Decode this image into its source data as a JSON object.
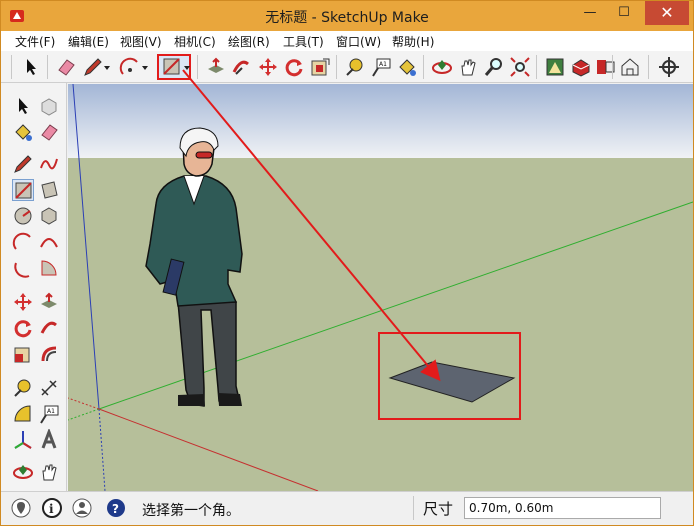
{
  "window": {
    "title": "无标题 - SketchUp Make",
    "minimize_glyph": "—",
    "maximize_glyph": "☐",
    "close_glyph": "✕"
  },
  "menu": {
    "items": [
      "文件(F)",
      "编辑(E)",
      "视图(V)",
      "相机(C)",
      "绘图(R)",
      "工具(T)",
      "窗口(W)",
      "帮助(H)"
    ]
  },
  "toolbar": {
    "icons": [
      "select-icon",
      "eraser-icon",
      "pencil-icon",
      "arc-icon",
      "rectangle-icon",
      "push-pull-icon",
      "follow-me-icon",
      "move-icon",
      "rotate-icon",
      "offset-icon",
      "tape-measure-icon",
      "text-icon",
      "paint-bucket-icon",
      "orbit-icon",
      "pan-icon",
      "zoom-icon",
      "zoom-extents-icon",
      "3d-warehouse-icon",
      "extension-icon",
      "components-icon",
      "house-icon",
      "position-camera-icon"
    ],
    "active": "rectangle-icon"
  },
  "status": {
    "message": "选择第一个角。",
    "measure_label": "尺寸",
    "measure_value": "0.70m, 0.60m"
  },
  "colors": {
    "titlebar": "#e9a63c",
    "sky_top": "#a3b6d6",
    "sky_bottom": "#f0f2f5",
    "ground": "#b6bf9a",
    "highlight_red": "#e21b1b",
    "axis_red": "#c53030",
    "axis_green": "#2fae2f",
    "axis_blue": "#2b3fb5",
    "rectangle_fill": "#5d6470"
  }
}
